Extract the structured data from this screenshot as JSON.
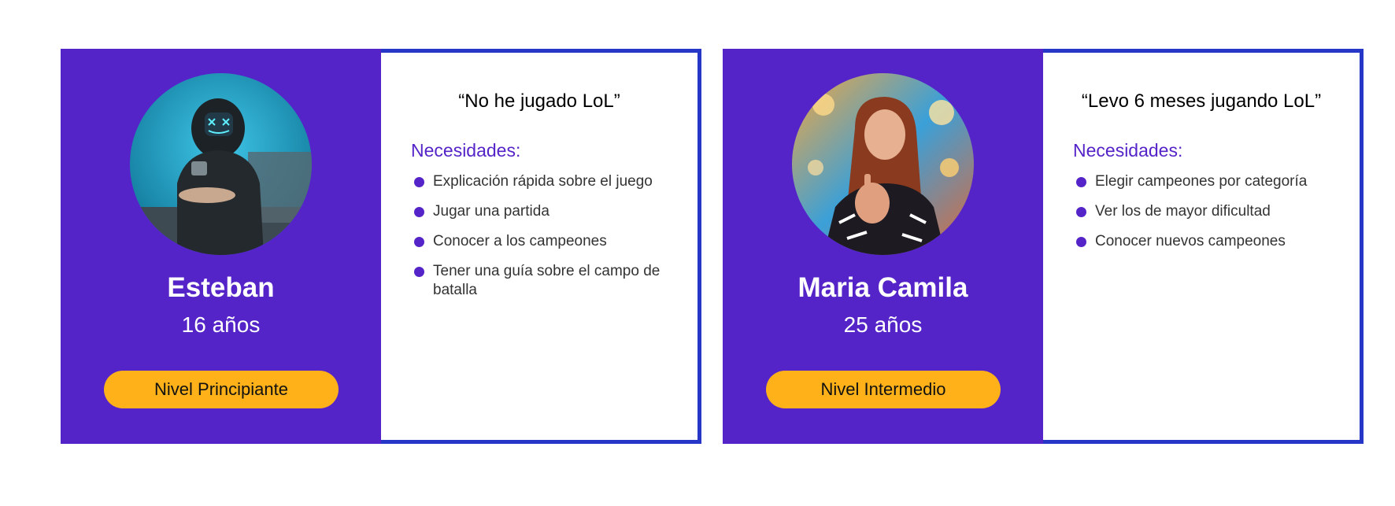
{
  "personas": [
    {
      "name": "Esteban",
      "age": "16 años",
      "level": "Nivel Principiante",
      "quote": "“No he jugado LoL”",
      "needs_title": "Necesidades:",
      "needs": [
        "Explicación rápida sobre el juego",
        "Jugar una partida",
        "Conocer a los campeones",
        "Tener una guía sobre el campo de batalla"
      ]
    },
    {
      "name": "Maria Camila",
      "age": "25 años",
      "level": "Nivel Intermedio",
      "quote": "“Levo 6 meses jugando LoL”",
      "needs_title": "Necesidades:",
      "needs": [
        "Elegir campeones por categoría",
        "Ver los de mayor dificultad",
        "Conocer nuevos campeones"
      ]
    }
  ],
  "colors": {
    "purple": "#5524c8",
    "border_blue": "#2637c7",
    "badge_yellow": "#ffb119"
  }
}
